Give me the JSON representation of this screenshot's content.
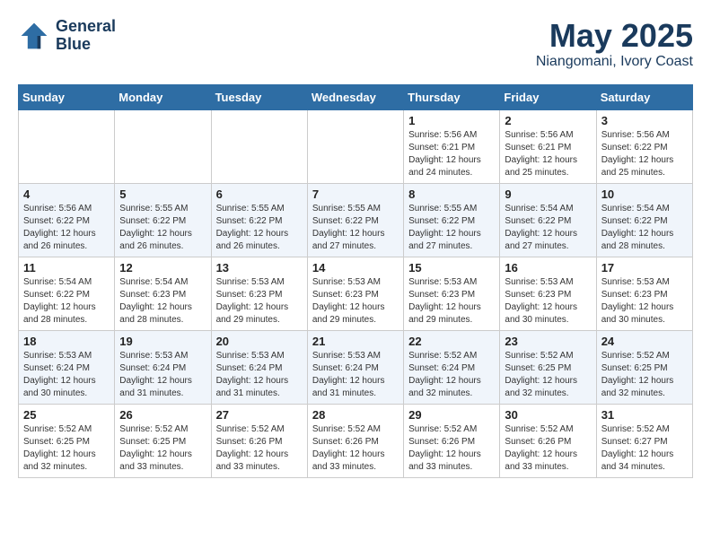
{
  "logo": {
    "line1": "General",
    "line2": "Blue"
  },
  "title": "May 2025",
  "location": "Niangomani, Ivory Coast",
  "weekdays": [
    "Sunday",
    "Monday",
    "Tuesday",
    "Wednesday",
    "Thursday",
    "Friday",
    "Saturday"
  ],
  "weeks": [
    [
      {
        "day": "",
        "info": ""
      },
      {
        "day": "",
        "info": ""
      },
      {
        "day": "",
        "info": ""
      },
      {
        "day": "",
        "info": ""
      },
      {
        "day": "1",
        "info": "Sunrise: 5:56 AM\nSunset: 6:21 PM\nDaylight: 12 hours\nand 24 minutes."
      },
      {
        "day": "2",
        "info": "Sunrise: 5:56 AM\nSunset: 6:21 PM\nDaylight: 12 hours\nand 25 minutes."
      },
      {
        "day": "3",
        "info": "Sunrise: 5:56 AM\nSunset: 6:22 PM\nDaylight: 12 hours\nand 25 minutes."
      }
    ],
    [
      {
        "day": "4",
        "info": "Sunrise: 5:56 AM\nSunset: 6:22 PM\nDaylight: 12 hours\nand 26 minutes."
      },
      {
        "day": "5",
        "info": "Sunrise: 5:55 AM\nSunset: 6:22 PM\nDaylight: 12 hours\nand 26 minutes."
      },
      {
        "day": "6",
        "info": "Sunrise: 5:55 AM\nSunset: 6:22 PM\nDaylight: 12 hours\nand 26 minutes."
      },
      {
        "day": "7",
        "info": "Sunrise: 5:55 AM\nSunset: 6:22 PM\nDaylight: 12 hours\nand 27 minutes."
      },
      {
        "day": "8",
        "info": "Sunrise: 5:55 AM\nSunset: 6:22 PM\nDaylight: 12 hours\nand 27 minutes."
      },
      {
        "day": "9",
        "info": "Sunrise: 5:54 AM\nSunset: 6:22 PM\nDaylight: 12 hours\nand 27 minutes."
      },
      {
        "day": "10",
        "info": "Sunrise: 5:54 AM\nSunset: 6:22 PM\nDaylight: 12 hours\nand 28 minutes."
      }
    ],
    [
      {
        "day": "11",
        "info": "Sunrise: 5:54 AM\nSunset: 6:22 PM\nDaylight: 12 hours\nand 28 minutes."
      },
      {
        "day": "12",
        "info": "Sunrise: 5:54 AM\nSunset: 6:23 PM\nDaylight: 12 hours\nand 28 minutes."
      },
      {
        "day": "13",
        "info": "Sunrise: 5:53 AM\nSunset: 6:23 PM\nDaylight: 12 hours\nand 29 minutes."
      },
      {
        "day": "14",
        "info": "Sunrise: 5:53 AM\nSunset: 6:23 PM\nDaylight: 12 hours\nand 29 minutes."
      },
      {
        "day": "15",
        "info": "Sunrise: 5:53 AM\nSunset: 6:23 PM\nDaylight: 12 hours\nand 29 minutes."
      },
      {
        "day": "16",
        "info": "Sunrise: 5:53 AM\nSunset: 6:23 PM\nDaylight: 12 hours\nand 30 minutes."
      },
      {
        "day": "17",
        "info": "Sunrise: 5:53 AM\nSunset: 6:23 PM\nDaylight: 12 hours\nand 30 minutes."
      }
    ],
    [
      {
        "day": "18",
        "info": "Sunrise: 5:53 AM\nSunset: 6:24 PM\nDaylight: 12 hours\nand 30 minutes."
      },
      {
        "day": "19",
        "info": "Sunrise: 5:53 AM\nSunset: 6:24 PM\nDaylight: 12 hours\nand 31 minutes."
      },
      {
        "day": "20",
        "info": "Sunrise: 5:53 AM\nSunset: 6:24 PM\nDaylight: 12 hours\nand 31 minutes."
      },
      {
        "day": "21",
        "info": "Sunrise: 5:53 AM\nSunset: 6:24 PM\nDaylight: 12 hours\nand 31 minutes."
      },
      {
        "day": "22",
        "info": "Sunrise: 5:52 AM\nSunset: 6:24 PM\nDaylight: 12 hours\nand 32 minutes."
      },
      {
        "day": "23",
        "info": "Sunrise: 5:52 AM\nSunset: 6:25 PM\nDaylight: 12 hours\nand 32 minutes."
      },
      {
        "day": "24",
        "info": "Sunrise: 5:52 AM\nSunset: 6:25 PM\nDaylight: 12 hours\nand 32 minutes."
      }
    ],
    [
      {
        "day": "25",
        "info": "Sunrise: 5:52 AM\nSunset: 6:25 PM\nDaylight: 12 hours\nand 32 minutes."
      },
      {
        "day": "26",
        "info": "Sunrise: 5:52 AM\nSunset: 6:25 PM\nDaylight: 12 hours\nand 33 minutes."
      },
      {
        "day": "27",
        "info": "Sunrise: 5:52 AM\nSunset: 6:26 PM\nDaylight: 12 hours\nand 33 minutes."
      },
      {
        "day": "28",
        "info": "Sunrise: 5:52 AM\nSunset: 6:26 PM\nDaylight: 12 hours\nand 33 minutes."
      },
      {
        "day": "29",
        "info": "Sunrise: 5:52 AM\nSunset: 6:26 PM\nDaylight: 12 hours\nand 33 minutes."
      },
      {
        "day": "30",
        "info": "Sunrise: 5:52 AM\nSunset: 6:26 PM\nDaylight: 12 hours\nand 33 minutes."
      },
      {
        "day": "31",
        "info": "Sunrise: 5:52 AM\nSunset: 6:27 PM\nDaylight: 12 hours\nand 34 minutes."
      }
    ]
  ]
}
